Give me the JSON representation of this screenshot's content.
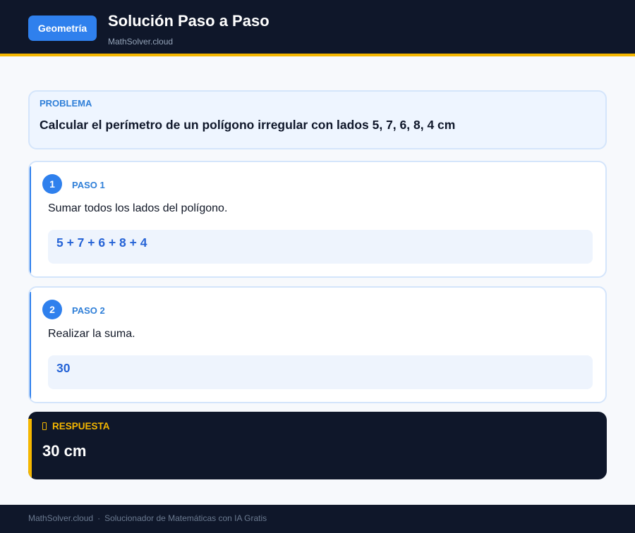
{
  "header": {
    "badge": "Geometría",
    "title": "Solución Paso a Paso",
    "subtitle": "MathSolver.cloud"
  },
  "problem": {
    "label": "PROBLEMA",
    "text": "Calcular el perímetro de un polígono irregular con lados 5, 7, 6, 8, 4 cm"
  },
  "steps": [
    {
      "number": "1",
      "label": "PASO 1",
      "description": "Sumar todos los lados del polígono.",
      "expression": "5 + 7 + 6 + 8 + 4"
    },
    {
      "number": "2",
      "label": "PASO 2",
      "description": "Realizar la suma.",
      "expression": "30"
    }
  ],
  "answer": {
    "icon": "lightbulb-icon",
    "label": "RESPUESTA",
    "value": "30 cm"
  },
  "footer": {
    "site": "MathSolver.cloud",
    "separator": "·",
    "tagline": "Solucionador de Matemáticas con IA Gratis"
  },
  "colors": {
    "header_bg": "#0f172a",
    "accent": "#2f80ed",
    "highlight": "#f5b700"
  }
}
